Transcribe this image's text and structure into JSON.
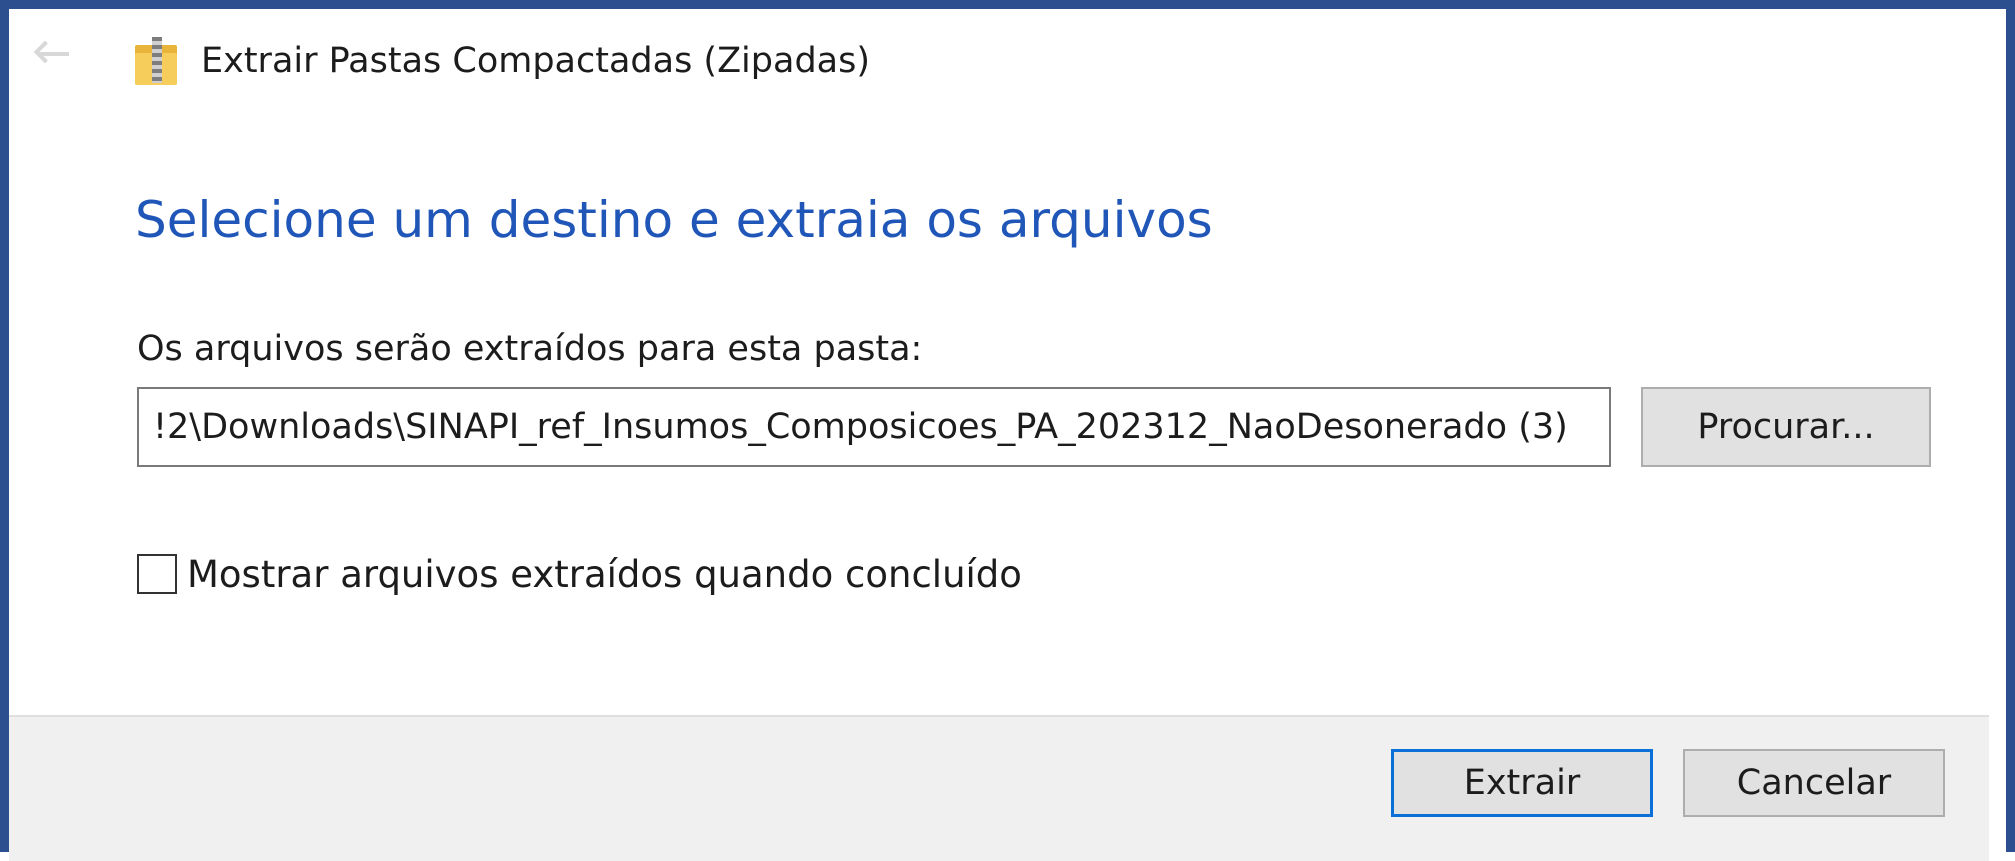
{
  "window": {
    "title": "Extrair Pastas Compactadas (Zipadas)",
    "icon": "zip-folder-icon",
    "back_icon": "back-arrow-icon",
    "accent_color": "#2b4f8f"
  },
  "main": {
    "heading": "Selecione um destino e extraia os arquivos",
    "heading_color": "#1f56b8",
    "folder_label": "Os arquivos serão extraídos para esta pasta:",
    "path_value": "!2\\Downloads\\SINAPI_ref_Insumos_Composicoes_PA_202312_NaoDesonerado (3)",
    "browse_label": "Procurar...",
    "show_files_label": "Mostrar arquivos extraídos quando concluído",
    "show_files_checked": false
  },
  "footer": {
    "extract_label": "Extrair",
    "cancel_label": "Cancelar",
    "focus_color": "#0a6fd6"
  }
}
